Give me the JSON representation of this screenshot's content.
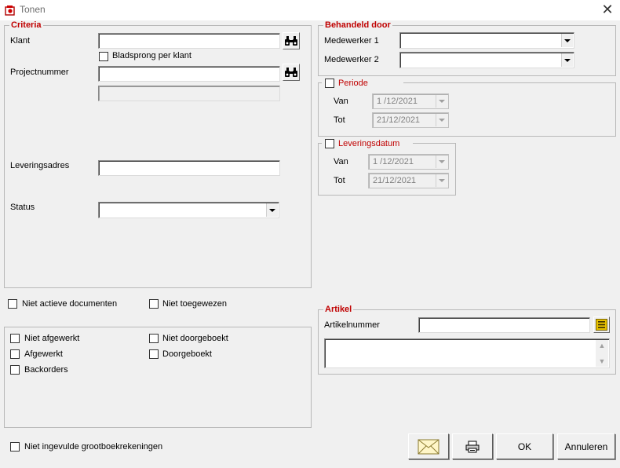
{
  "window": {
    "title": "Tonen",
    "close_icon": "close-icon"
  },
  "criteria": {
    "legend": "Criteria",
    "klant_label": "Klant",
    "klant_value": "",
    "bladsprong_label": "Bladsprong per klant",
    "projectnummer_label": "Projectnummer",
    "projectnummer_value": "",
    "project_desc_value": "",
    "leveringsadres_label": "Leveringsadres",
    "leveringsadres_value": "",
    "status_label": "Status",
    "status_value": ""
  },
  "behandeld": {
    "legend": "Behandeld door",
    "medewerker1_label": "Medewerker 1",
    "medewerker1_value": "",
    "medewerker2_label": "Medewerker 2",
    "medewerker2_value": ""
  },
  "periode": {
    "legend": "Periode",
    "van_label": "Van",
    "van_value": "1 /12/2021",
    "tot_label": "Tot",
    "tot_value": "21/12/2021"
  },
  "leveringsdatum": {
    "legend": "Leveringsdatum",
    "van_label": "Van",
    "van_value": "1 /12/2021",
    "tot_label": "Tot",
    "tot_value": "21/12/2021"
  },
  "options": {
    "niet_actieve": "Niet actieve documenten",
    "niet_toegewezen": "Niet toegewezen",
    "niet_afgewerkt": "Niet afgewerkt",
    "niet_doorgeboekt": "Niet doorgeboekt",
    "afgewerkt": "Afgewerkt",
    "doorgeboekt": "Doorgeboekt",
    "backorders": "Backorders",
    "niet_ingevulde": "Niet ingevulde grootboekrekeningen"
  },
  "artikel": {
    "legend": "Artikel",
    "artikelnummer_label": "Artikelnummer",
    "artikelnummer_value": ""
  },
  "buttons": {
    "ok": "OK",
    "annuleren": "Annuleren",
    "mail_icon": "envelope-icon",
    "print_icon": "printer-icon"
  },
  "colors": {
    "accent": "#c00000",
    "background": "#f0f0f0"
  }
}
